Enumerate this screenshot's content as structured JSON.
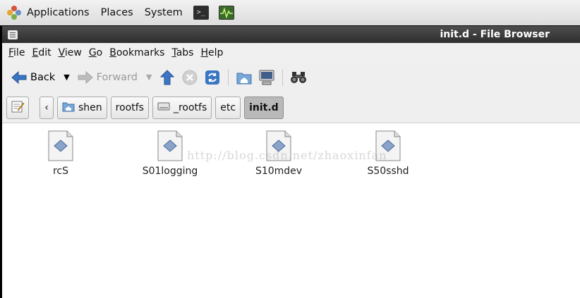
{
  "panel": {
    "applications_label": "Applications",
    "places_label": "Places",
    "system_label": "System"
  },
  "window": {
    "title": "init.d - File Browser"
  },
  "menubar": {
    "items": [
      {
        "label": "File",
        "accel": "F",
        "rest": "ile"
      },
      {
        "label": "Edit",
        "accel": "E",
        "rest": "dit"
      },
      {
        "label": "View",
        "accel": "V",
        "rest": "iew"
      },
      {
        "label": "Go",
        "accel": "G",
        "rest": "o"
      },
      {
        "label": "Bookmarks",
        "accel": "B",
        "rest": "ookmarks"
      },
      {
        "label": "Tabs",
        "accel": "T",
        "rest": "abs"
      },
      {
        "label": "Help",
        "accel": "H",
        "rest": "elp"
      }
    ]
  },
  "toolbar": {
    "back_label": "Back",
    "forward_label": "Forward"
  },
  "pathbar": {
    "segments": [
      "shen",
      "rootfs",
      "_rootfs",
      "etc",
      "init.d"
    ]
  },
  "files": [
    {
      "name": "rcS"
    },
    {
      "name": "S01logging"
    },
    {
      "name": "S10mdev"
    },
    {
      "name": "S50sshd"
    }
  ],
  "watermark": "http://blog.csdn.net/zhaoxinfan"
}
